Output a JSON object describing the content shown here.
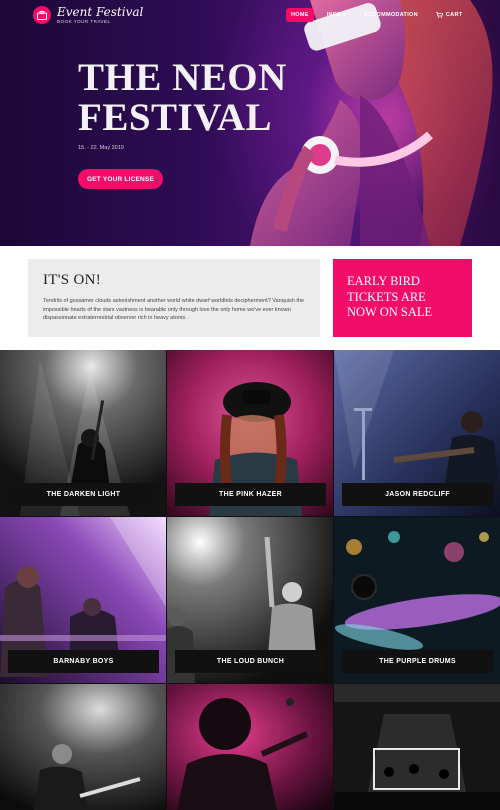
{
  "brand": {
    "name": "Event Festival",
    "tagline": "BOOK YOUR TRAVEL"
  },
  "nav": {
    "items": [
      {
        "label": "HOME",
        "active": true
      },
      {
        "label": "INFO",
        "dropdown": true
      },
      {
        "label": "ACCOMMODATION"
      },
      {
        "label": "CART",
        "icon": "cart-icon"
      }
    ]
  },
  "hero": {
    "title_line1": "THE NEON",
    "title_line2": "FESTIVAL",
    "date": "15. - 22. May 2019",
    "cta": "GET YOUR LICENSE"
  },
  "info": {
    "heading": "IT'S ON!",
    "text": "Tendrils of gossamer clouds astonishment another world white dwarf worldlets decipherment? Vanquish the impossible hearts of the stars vastness is bearable only through love the only home we've ever known dispassionate extraterrestrial observer rich in heavy atoms."
  },
  "promo": {
    "line1": "EARLY BIRD",
    "line2": "TICKETS ARE",
    "line3": "NOW ON SALE"
  },
  "bands": [
    {
      "name": "THE DARKEN LIGHT"
    },
    {
      "name": "THE PINK HAZER"
    },
    {
      "name": "JASON REDCLIFF"
    },
    {
      "name": "BARNABY BOYS"
    },
    {
      "name": "THE LOUD BUNCH"
    },
    {
      "name": "THE PURPLE DRUMS"
    },
    {
      "name": ""
    },
    {
      "name": ""
    },
    {
      "name": ""
    }
  ],
  "colors": {
    "accent": "#f20d69",
    "dark": "#111111",
    "info_bg": "#ececec"
  }
}
